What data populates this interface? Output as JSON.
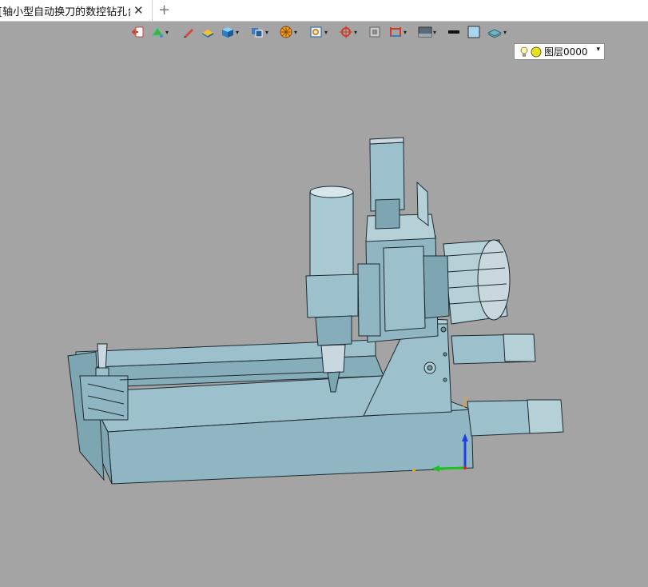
{
  "tab": {
    "title": "[轴小型自动换刀的数控钻孔台]",
    "close_glyph": "✕",
    "add_glyph": "+"
  },
  "toolbar": {
    "tools": [
      {
        "name": "exit-sketch-icon"
      },
      {
        "name": "fill-icon"
      },
      {
        "name": "pencil-icon"
      },
      {
        "name": "render-mode-icon"
      },
      {
        "name": "shaded-cube-icon"
      },
      {
        "name": "view-cube-icon"
      },
      {
        "name": "color-wheel-icon"
      },
      {
        "name": "zoom-fit-icon"
      },
      {
        "name": "pan-target-icon"
      },
      {
        "name": "section-icon"
      },
      {
        "name": "measure-icon"
      },
      {
        "name": "background-icon"
      },
      {
        "name": "line-color-icon"
      },
      {
        "name": "face-color-icon"
      },
      {
        "name": "layer-manager-icon"
      }
    ],
    "layer": {
      "value": "图层0000",
      "caret": "▾"
    }
  },
  "colors": {
    "viewport_bg": "#a4a4a4",
    "model": "#9cc0cc",
    "model_dark": "#6f97a4",
    "edge": "#1c2a30"
  }
}
